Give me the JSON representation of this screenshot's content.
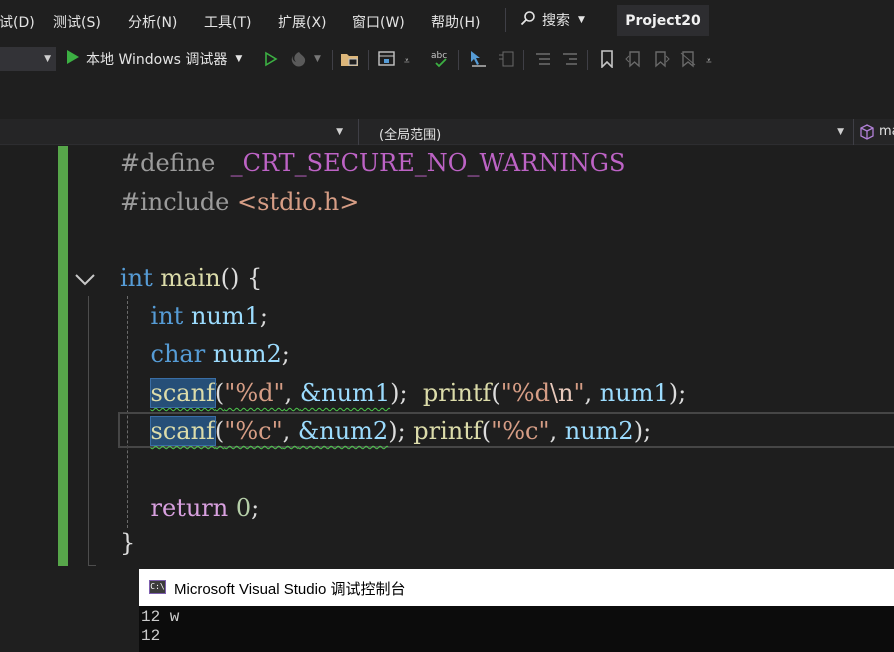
{
  "menu": {
    "items": [
      "试(D)",
      "测试(S)",
      "分析(N)",
      "工具(T)",
      "扩展(X)",
      "窗口(W)",
      "帮助(H)"
    ],
    "search_label": "搜索",
    "project_title": "Project20"
  },
  "toolbar": {
    "run_label": "本地 Windows 调试器"
  },
  "navbar": {
    "scope_label": "(全局范围)",
    "member_label": "ma"
  },
  "editor": {
    "lines": {
      "define_directive": "#define",
      "define_macro": "_CRT_SECURE_NO_WARNINGS",
      "include_directive": "#include",
      "include_header": "<stdio.h>",
      "main_type": "int",
      "main_name": "main",
      "main_parens": "() {",
      "decl1_type": "int",
      "decl1_name": "num1",
      "decl2_type": "char",
      "decl2_name": "num2",
      "scanf_fn": "scanf",
      "fmt_d": "\"%d\"",
      "arg_num1": "&num1",
      "printf_fn": "printf",
      "fmt_dn_pre": "\"%d",
      "fmt_dn_esc": "\\n",
      "fmt_dn_post": "\"",
      "fmt_c": "\"%c\"",
      "arg_num2": "&num2",
      "var_num1": "num1",
      "var_num2": "num2",
      "return_kw": "return",
      "return_val": "0",
      "close_brace": "}"
    }
  },
  "console": {
    "title": "Microsoft Visual Studio 调试控制台",
    "icon_text": "C:\\",
    "output": [
      "12 w",
      "12"
    ]
  },
  "colors": {
    "change_bar": "#57a64a",
    "keyword": "#569cd6",
    "function": "#dcdcaa",
    "string": "#d69d85",
    "variable": "#9cdcfe",
    "control": "#d8a0df",
    "selection": "#264f78"
  }
}
